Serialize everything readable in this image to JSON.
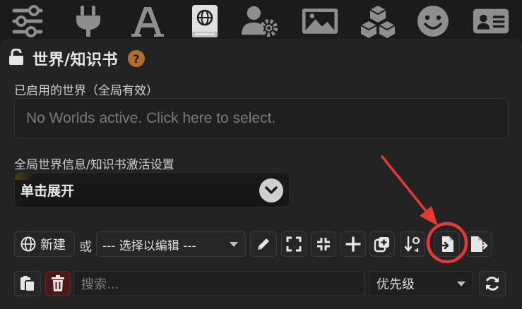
{
  "topbar": {
    "icons": [
      "sliders-icon",
      "plug-icon",
      "font-icon",
      "world-book-icon",
      "user-settings-icon",
      "image-icon",
      "cubes-icon",
      "smile-icon",
      "id-card-icon"
    ],
    "active_icon": "world-book-icon"
  },
  "panel": {
    "title": "世界/知识书",
    "help": "?",
    "active_worlds_label": "已启用的世界（全局有效）",
    "active_worlds_placeholder": "No Worlds active. Click here to select.",
    "global_settings_label": "全局世界信息/知识书激活设置",
    "expander_label": "单击展开"
  },
  "toolbar": {
    "new_label": "新建",
    "or_label": "或",
    "select_placeholder": "--- 选择以编辑 ---",
    "buttons": [
      "pencil-icon",
      "expand-icon",
      "compress-icon",
      "plus-icon",
      "duplicate-icon",
      "sort-icon",
      "import-icon",
      "export-icon"
    ]
  },
  "filter": {
    "search_placeholder": "搜索...",
    "sort_value": "优先级"
  },
  "colors": {
    "background": "#1b1b1b",
    "panel": "#232323",
    "help_badge": "#b36d2a",
    "highlight": "#e53935",
    "delete": "#7a1e1e"
  }
}
